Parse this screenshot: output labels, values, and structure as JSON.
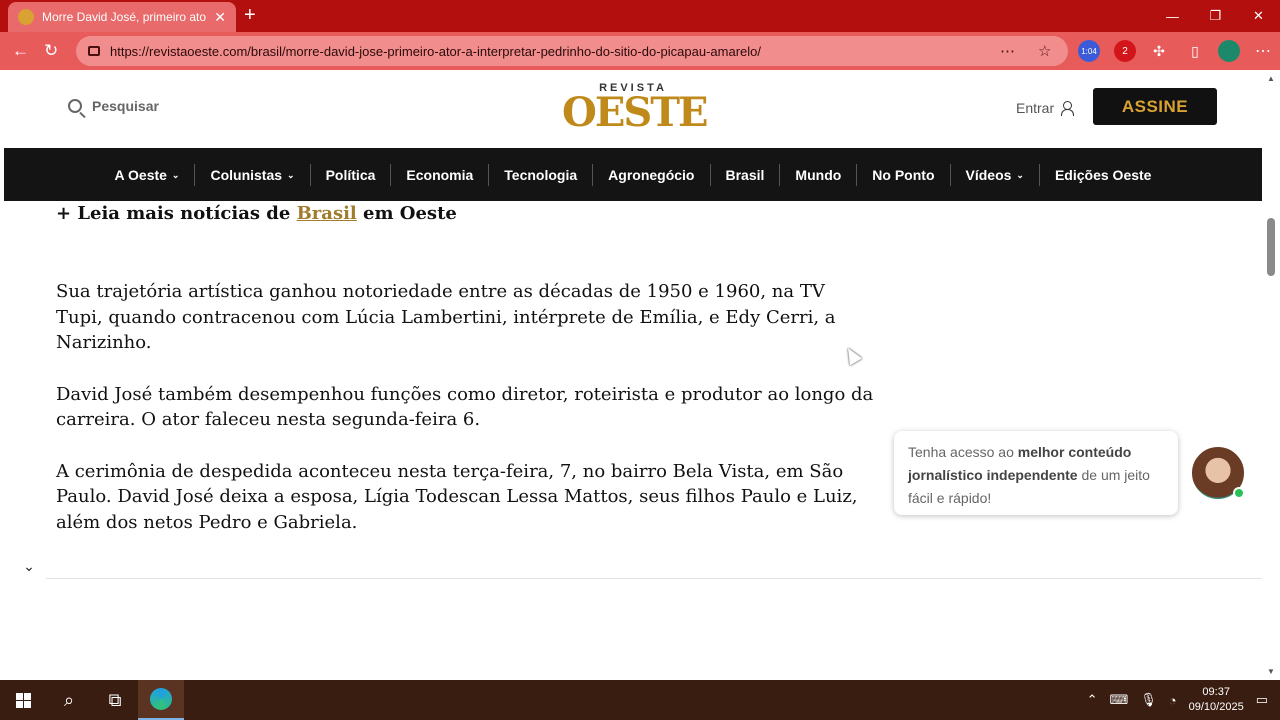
{
  "browser": {
    "tab_title": "Morre David José, primeiro ator a",
    "url": "https://revistaoeste.com/brasil/morre-david-jose-primeiro-ator-a-interpretar-pedrinho-do-sitio-do-picapau-amarelo/",
    "ext_badge_1": "1:04",
    "ext_badge_2": "2"
  },
  "header": {
    "search_label": "Pesquisar",
    "logo_top": "REVISTA",
    "logo_main": "OESTE",
    "login_label": "Entrar",
    "subscribe_label": "ASSINE"
  },
  "nav": {
    "items": [
      {
        "label": "A Oeste",
        "dropdown": true
      },
      {
        "label": "Colunistas",
        "dropdown": true
      },
      {
        "label": "Política",
        "dropdown": false
      },
      {
        "label": "Economia",
        "dropdown": false
      },
      {
        "label": "Tecnologia",
        "dropdown": false
      },
      {
        "label": "Agronegócio",
        "dropdown": false
      },
      {
        "label": "Brasil",
        "dropdown": false
      },
      {
        "label": "Mundo",
        "dropdown": false
      },
      {
        "label": "No Ponto",
        "dropdown": false
      },
      {
        "label": "Vídeos",
        "dropdown": true
      },
      {
        "label": "Edições Oeste",
        "dropdown": false
      }
    ]
  },
  "article": {
    "more_prefix": "+ Leia mais notícias de ",
    "more_link": "Brasil",
    "more_suffix": " em Oeste",
    "paragraphs": [
      "Sua trajetória artística ganhou notoriedade entre as décadas de 1950 e 1960, na TV Tupi, quando contracenou com Lúcia Lambertini, intérprete de Emília, e Edy Cerri, a Narizinho.",
      "David José também desempenhou funções como diretor, roteirista e produtor ao longo da carreira. O ator faleceu nesta segunda-feira 6.",
      "A cerimônia de despedida aconteceu nesta terça-feira, 7, no bairro Bela Vista, em São Paulo. David José deixa a esposa, Lígia Todescan Lessa Mattos, seus filhos Paulo e Luiz, além dos netos Pedro e Gabriela."
    ]
  },
  "promo": {
    "text_1": "Tenha acesso ao ",
    "text_bold": "melhor conteúdo jornalístico independente",
    "text_2": " de um jeito fácil e rápido!"
  },
  "taskbar": {
    "time": "09:37",
    "date": "09/10/2025"
  }
}
